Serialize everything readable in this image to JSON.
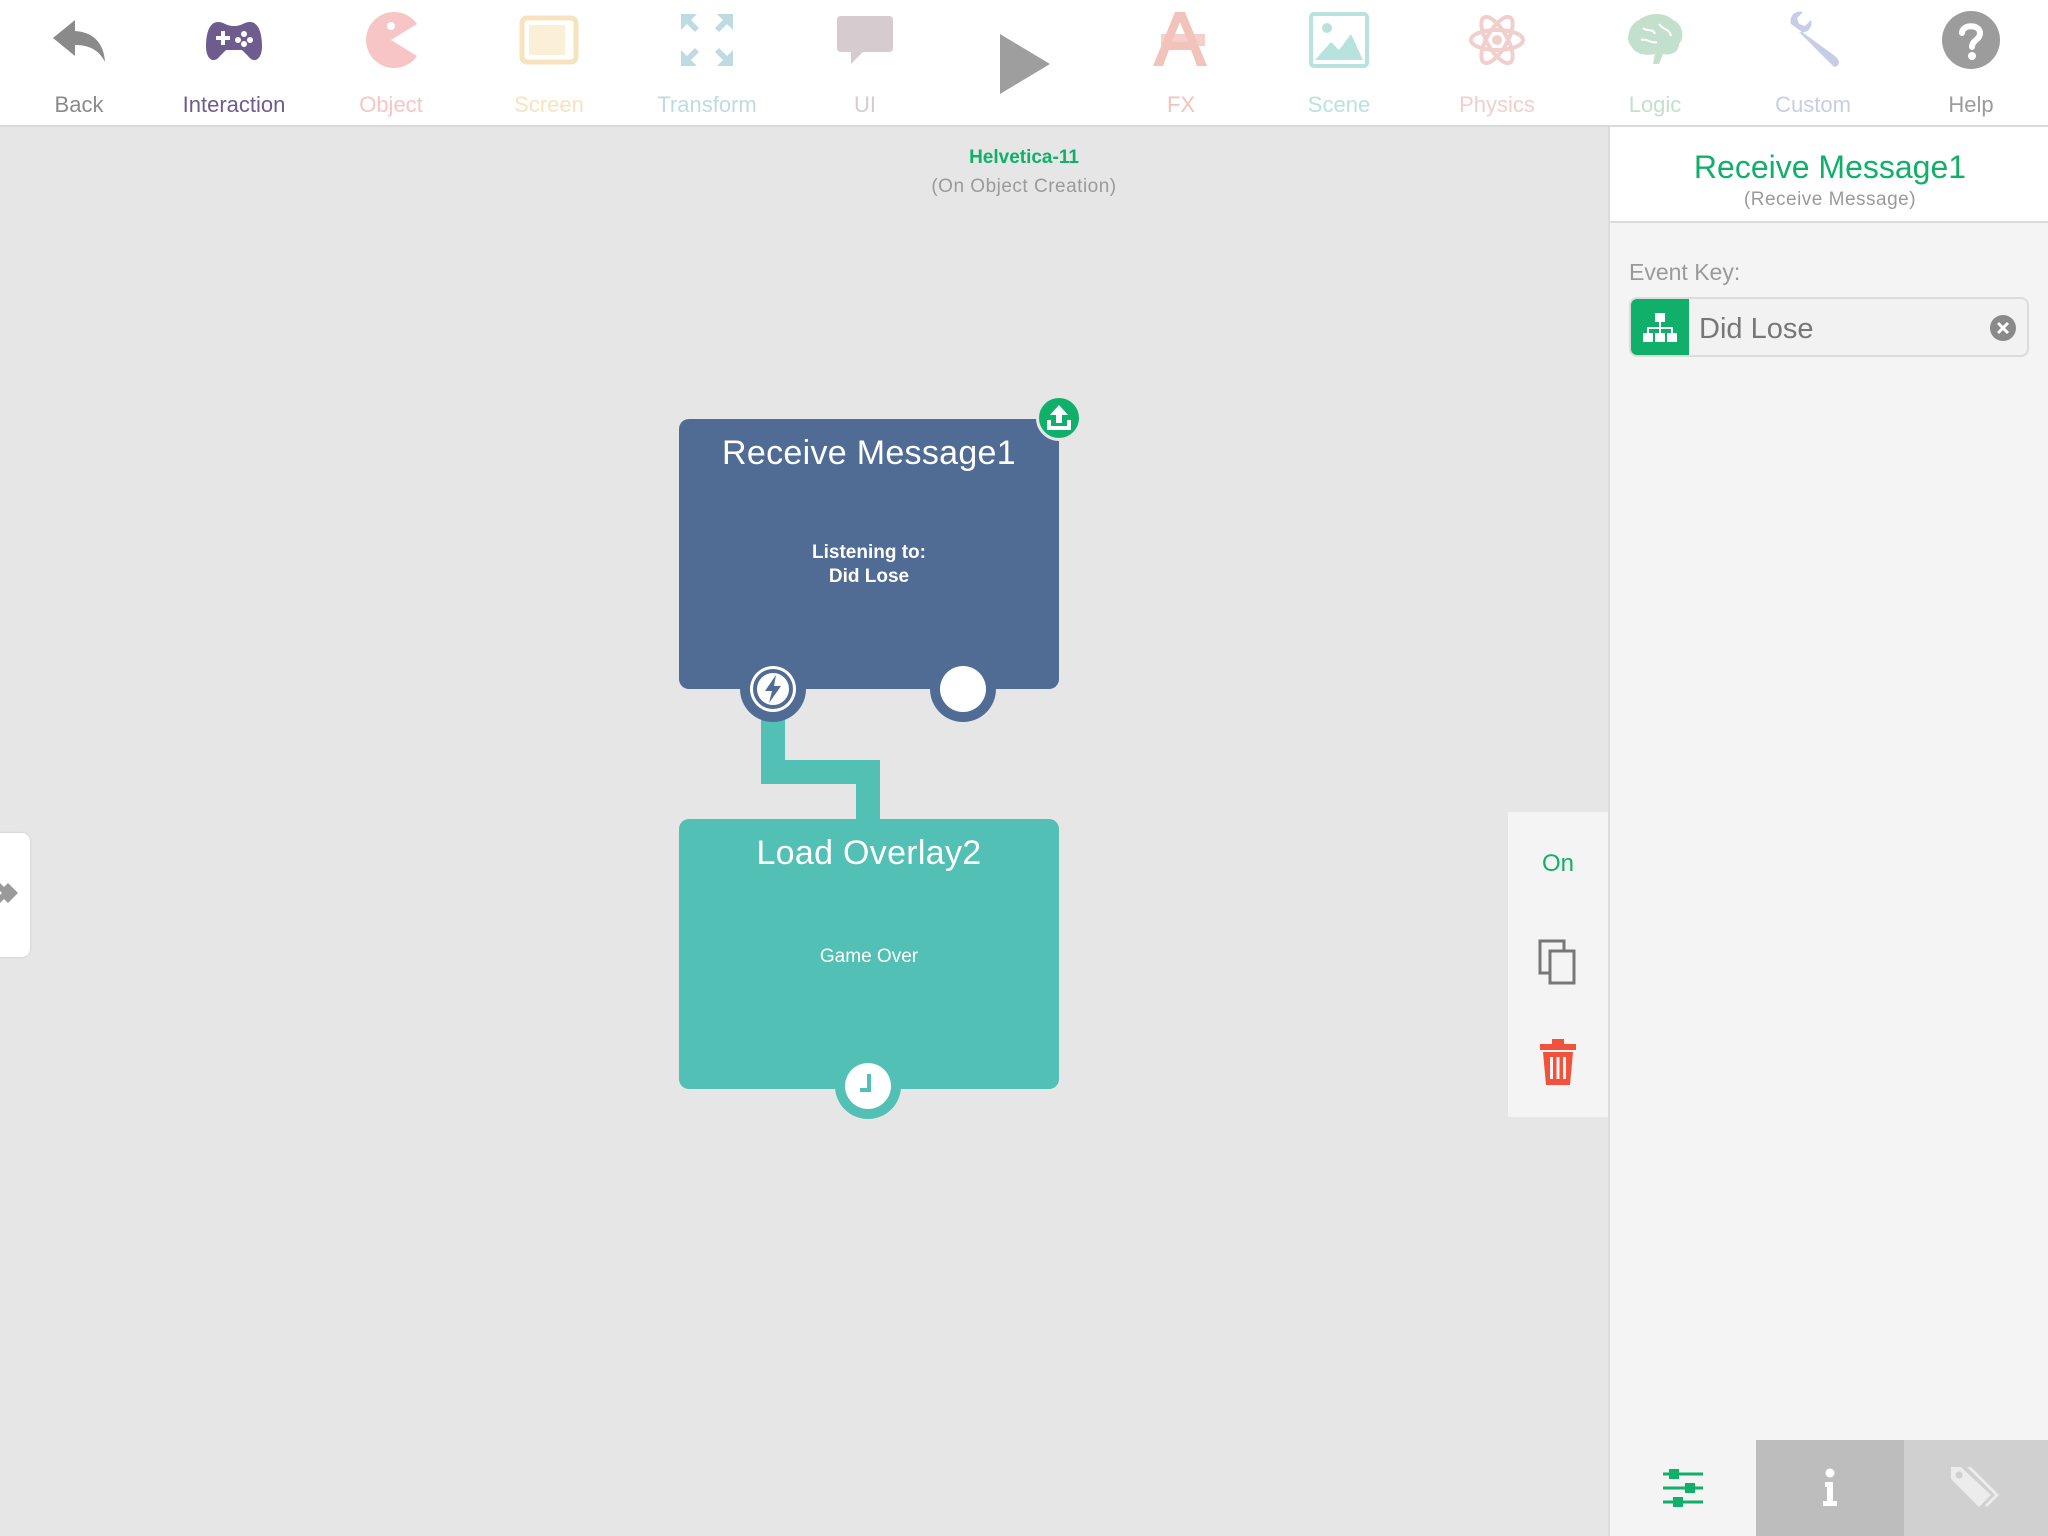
{
  "toolbar": {
    "items": [
      {
        "label": "Back",
        "icon": "back-arrow-icon",
        "color": "#8a8a8a"
      },
      {
        "label": "Interaction",
        "icon": "gamepad-icon",
        "color": "#6f5c8f"
      },
      {
        "label": "Object",
        "icon": "pacman-icon",
        "color": "#f7c5c5"
      },
      {
        "label": "Screen",
        "icon": "tablet-icon",
        "color": "#f7e3bd"
      },
      {
        "label": "Transform",
        "icon": "arrows-expand-icon",
        "color": "#bfdbe2"
      },
      {
        "label": "UI",
        "icon": "speech-bubble-icon",
        "color": "#d6cccf"
      },
      {
        "label": "FX",
        "icon": "fx-icon",
        "color": "#f2c3bb"
      },
      {
        "label": "Scene",
        "icon": "landscape-image-icon",
        "color": "#b8e3dc"
      },
      {
        "label": "Physics",
        "icon": "atom-icon",
        "color": "#f0cfcc"
      },
      {
        "label": "Logic",
        "icon": "brain-icon",
        "color": "#c2e0cc"
      },
      {
        "label": "Custom",
        "icon": "wrench-icon",
        "color": "#c7cde6"
      },
      {
        "label": "Help",
        "icon": "question-circle-icon",
        "color": "#9c9c9c"
      }
    ],
    "play_icon": "play-icon"
  },
  "canvas": {
    "owner_name": "Helvetica-11",
    "owner_event": "(On Object Creation)"
  },
  "blocks": {
    "receive": {
      "title": "Receive Message1",
      "line1": "Listening to:",
      "line2": "Did Lose",
      "color": "#506c95"
    },
    "overlay": {
      "title": "Load Overlay2",
      "line1": "Game Over",
      "color": "#52c0b4"
    }
  },
  "actions": {
    "toggle": "On",
    "copy_icon": "copy-icon",
    "delete_icon": "trash-icon"
  },
  "inspector": {
    "title": "Receive Message1",
    "subtitle": "(Receive Message)",
    "event_key_label": "Event Key:",
    "event_key_value": "Did Lose",
    "accent": "#10b06a"
  },
  "tabs": [
    "sliders-icon",
    "info-icon",
    "tag-icon"
  ]
}
